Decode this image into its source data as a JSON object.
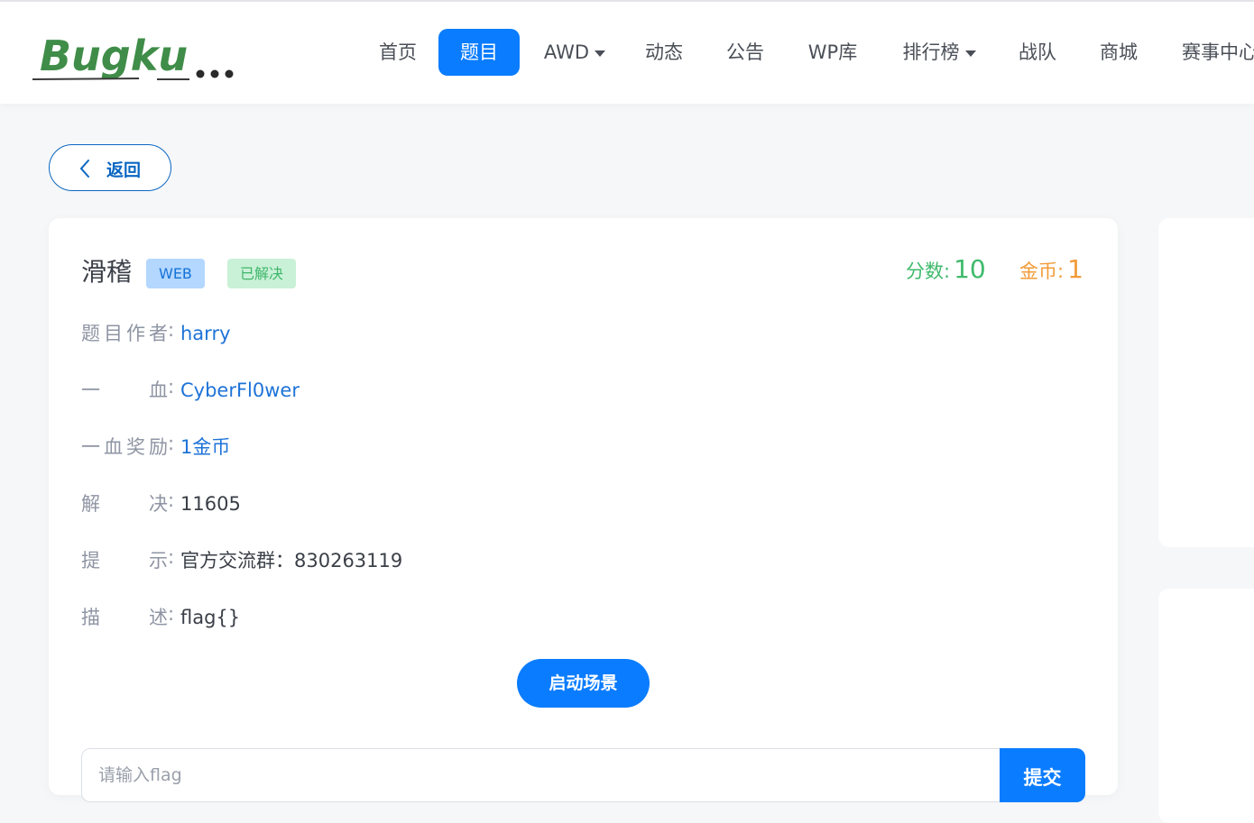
{
  "brand": {
    "logo_text": "Bugku..."
  },
  "nav": {
    "items": [
      {
        "label": "首页",
        "active": false,
        "dropdown": false
      },
      {
        "label": "题目",
        "active": true,
        "dropdown": false
      },
      {
        "label": "AWD",
        "active": false,
        "dropdown": true
      },
      {
        "label": "动态",
        "active": false,
        "dropdown": false
      },
      {
        "label": "公告",
        "active": false,
        "dropdown": false
      },
      {
        "label": "WP库",
        "active": false,
        "dropdown": false
      },
      {
        "label": "排行榜",
        "active": false,
        "dropdown": true
      },
      {
        "label": "战队",
        "active": false,
        "dropdown": false
      },
      {
        "label": "商城",
        "active": false,
        "dropdown": false
      },
      {
        "label": "赛事中心",
        "active": false,
        "dropdown": false
      }
    ]
  },
  "back_button": {
    "label": "返回",
    "icon": "chevron-left-icon"
  },
  "challenge": {
    "title": "滑稽",
    "category": "WEB",
    "status": "已解决",
    "score_label": "分数:",
    "score_value": "10",
    "coins_label": "金币:",
    "coins_value": "1",
    "details": [
      {
        "key_chars": [
          "题",
          "目",
          "作",
          "者"
        ],
        "value": "harry",
        "link": true
      },
      {
        "key_chars": [
          "一",
          "血"
        ],
        "value": "CyberFl0wer",
        "link": true
      },
      {
        "key_chars": [
          "一",
          "血",
          "奖",
          "励"
        ],
        "value": "1金币",
        "link": true
      },
      {
        "key_chars": [
          "解",
          "决"
        ],
        "value": "11605",
        "link": false
      },
      {
        "key_chars": [
          "提",
          "示"
        ],
        "value": "官方交流群：830263119",
        "link": false
      },
      {
        "key_chars": [
          "描",
          "述"
        ],
        "value": "flag{}",
        "link": false
      }
    ],
    "start_button": "启动场景",
    "flag_placeholder": "请输入flag",
    "submit_label": "提交"
  },
  "colors": {
    "accent": "#0a7cff",
    "score_green": "#3fba6c",
    "coin_orange": "#f29b38",
    "link_blue": "#1e73d8"
  }
}
